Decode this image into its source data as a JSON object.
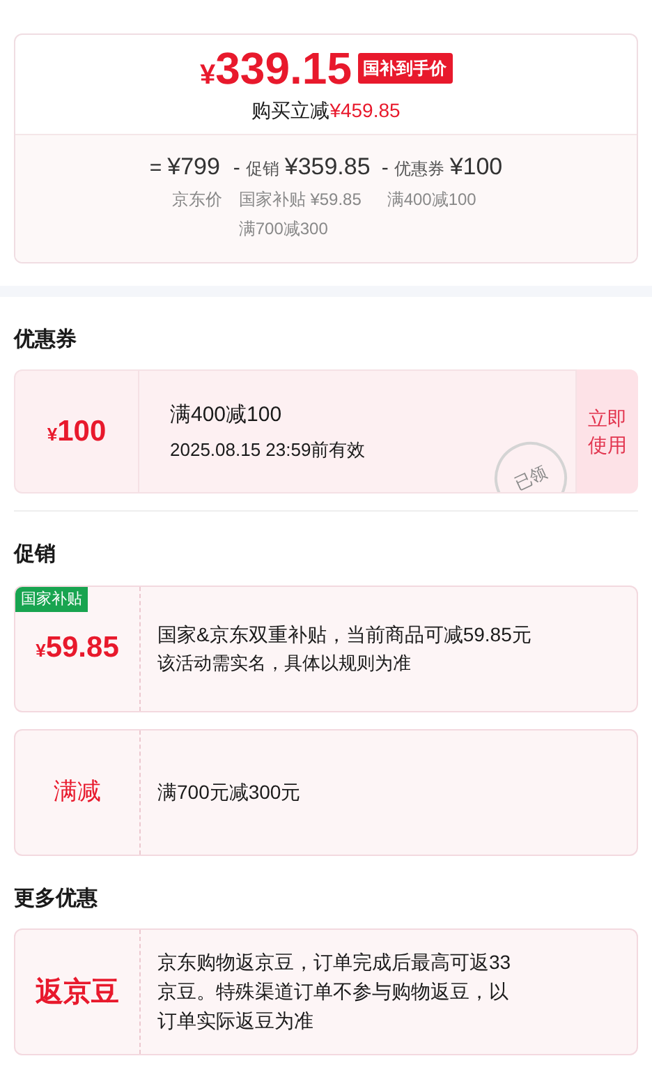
{
  "price_summary": {
    "symbol": "¥",
    "price": "339.15",
    "tag": "国补到手价",
    "savings_label": "购买立减",
    "savings_amount": "¥459.85",
    "breakdown": [
      {
        "operator": "=",
        "amount": "¥799",
        "notes": [
          "京东价"
        ]
      },
      {
        "operator": "-",
        "label": "促销",
        "amount": "¥359.85",
        "notes": [
          "国家补贴 ¥59.85",
          "满700减300"
        ]
      },
      {
        "operator": "-",
        "label": "优惠券",
        "amount": "¥100",
        "notes": [
          "满400减100"
        ]
      }
    ]
  },
  "coupons": {
    "title": "优惠券",
    "items": [
      {
        "symbol": "¥",
        "amount": "100",
        "title": "满400减100",
        "validity": "2025.08.15 23:59前有效",
        "stamp": "已领",
        "action": "立即使用"
      }
    ]
  },
  "promotions": {
    "title": "促销",
    "items": [
      {
        "kind": "amount",
        "badge": "国家补贴",
        "symbol": "¥",
        "amount": "59.85",
        "lines": [
          "国家&京东双重补贴，当前商品可减59.85元",
          "该活动需实名，具体以规则为准"
        ]
      },
      {
        "kind": "label",
        "label": "满减",
        "lines": [
          "满700元减300元"
        ]
      }
    ]
  },
  "more_offers": {
    "title": "更多优惠",
    "items": [
      {
        "kind": "label",
        "label": "返京豆",
        "lines": [
          "京东购物返京豆，订单完成后最高可返33京豆。特殊渠道订单不参与购物返豆，以订单实际返豆为准"
        ]
      }
    ]
  }
}
